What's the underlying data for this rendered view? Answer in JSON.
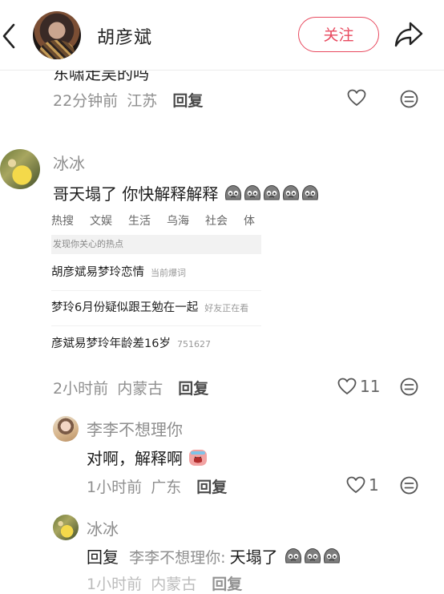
{
  "header": {
    "title": "胡彦斌",
    "follow_label": "关注"
  },
  "top_comment": {
    "text_partial": "东啸走吴的吗",
    "time": "22分钟前",
    "location": "江苏",
    "reply_label": "回复"
  },
  "comment_bingbing": {
    "name": "冰冰",
    "text": "哥天塌了 你快解释解释",
    "emoji_count": 5,
    "time": "2小时前",
    "location": "内蒙古",
    "reply_label": "回复",
    "like_count": "11",
    "embedded": {
      "tabs": [
        "热搜",
        "文娱",
        "生活",
        "乌海",
        "社会",
        "体"
      ],
      "bar_text": "发现你关心的热点",
      "rows": [
        {
          "text": "胡彦斌易梦玲恋情",
          "tag": "当前爆词"
        },
        {
          "text": "梦玲6月份疑似跟王勉在一起",
          "tag": "好友正在看"
        },
        {
          "text": "彦斌易梦玲年龄差16岁",
          "tag": "751627"
        }
      ]
    }
  },
  "reply_lili": {
    "name": "李李不想理你",
    "text": "对啊，解释啊",
    "time": "1小时前",
    "location": "广东",
    "reply_label": "回复",
    "like_count": "1"
  },
  "reply_bingbing": {
    "name": "冰冰",
    "reply_prefix": "回复",
    "reply_target": "李李不想理你:",
    "text": "天塌了",
    "time": "1小时前",
    "location": "内蒙古",
    "reply_label": "回复"
  },
  "colors": {
    "accent": "#e84a5f",
    "muted": "#8f8f8f"
  },
  "icons": [
    "back-icon",
    "share-icon",
    "heart-icon",
    "dislike-icon",
    "cry-emoji",
    "crying-face-emoji"
  ]
}
